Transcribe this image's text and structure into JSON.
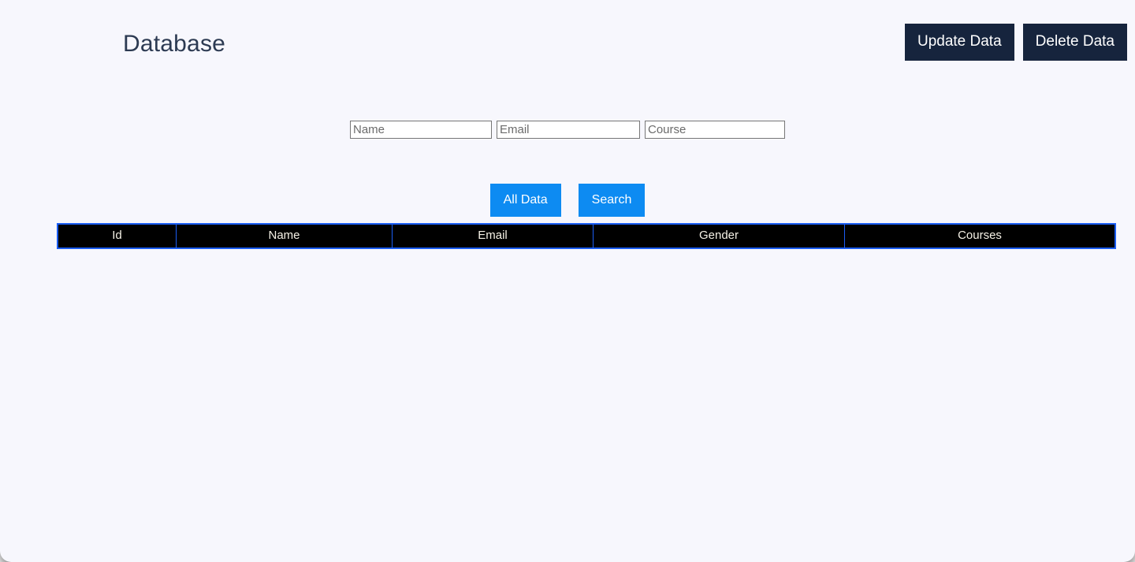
{
  "header": {
    "title": "Database",
    "buttons": [
      {
        "label": "Update Data",
        "name": "update-data-button"
      },
      {
        "label": "Delete Data",
        "name": "delete-data-button"
      }
    ]
  },
  "search_form": {
    "fields": [
      {
        "name": "name-input",
        "placeholder": "Name",
        "value": ""
      },
      {
        "name": "email-input",
        "placeholder": "Email",
        "value": ""
      },
      {
        "name": "course-input",
        "placeholder": "Course",
        "value": ""
      }
    ]
  },
  "actions": {
    "all_data_label": "All Data",
    "search_label": "Search"
  },
  "table": {
    "columns": [
      "Id",
      "Name",
      "Email",
      "Gender",
      "Courses"
    ],
    "rows": []
  },
  "colors": {
    "page_background": "#f7f7fd",
    "nav_button": "#16243d",
    "accent_blue": "#0d8bf2",
    "table_border": "#1b5df5",
    "table_header_background": "#000000",
    "title_text": "#2c3a52"
  }
}
